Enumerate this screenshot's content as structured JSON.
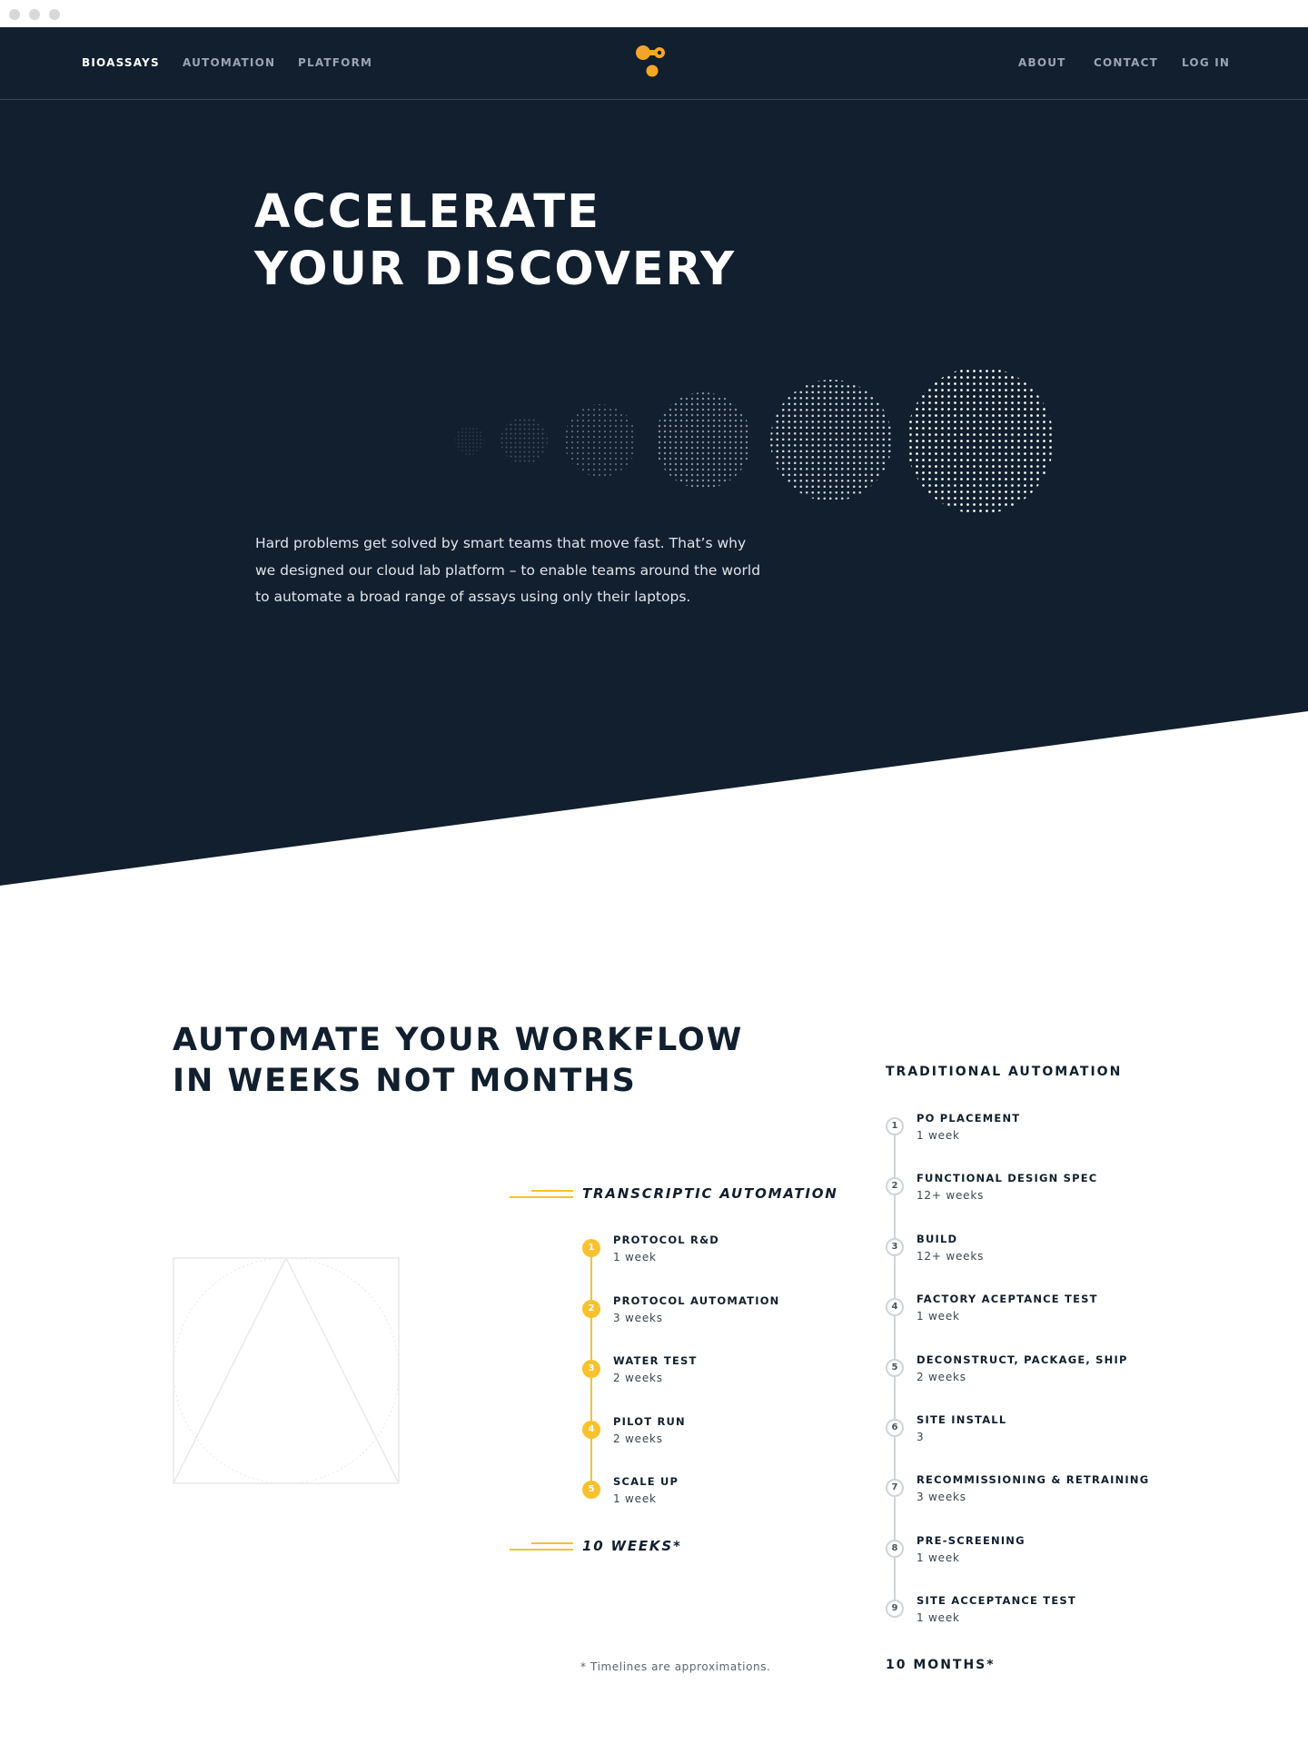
{
  "colors": {
    "navy": "#111f2e",
    "accent_yellow": "#f8c12d",
    "logo_orange": "#f6a623",
    "muted_grey": "#d0d4d8"
  },
  "browser": {
    "icons": [
      "window-dot-icon",
      "window-dot-icon",
      "window-dot-icon"
    ]
  },
  "nav": {
    "left": [
      {
        "label": "BIOASSAYS",
        "active": true
      },
      {
        "label": "AUTOMATION",
        "active": false
      },
      {
        "label": "PLATFORM",
        "active": false
      }
    ],
    "right": [
      {
        "label": "ABOUT"
      },
      {
        "label": "CONTACT"
      },
      {
        "label": "LOG IN"
      }
    ],
    "logo_icon": "transcriptic-logo-icon"
  },
  "hero": {
    "title_line1": "ACCELERATE",
    "title_line2": "YOUR DISCOVERY",
    "graphic_icon": "dotted-circles-graphic",
    "body": "Hard problems get solved by smart teams that move fast. That’s why we designed our cloud lab platform – to enable teams around the world to  automate a broad range of assays using only their laptops."
  },
  "workflow": {
    "title_line1": "AUTOMATE YOUR WORKFLOW",
    "title_line2": "IN WEEKS NOT MONTHS",
    "illustration_icon": "triangle-circle-square-icon",
    "transcriptic": {
      "heading": "TRANSCRIPTIC AUTOMATION",
      "steps": [
        {
          "num": "1",
          "name": "PROTOCOL R&D",
          "duration": "1 week"
        },
        {
          "num": "2",
          "name": "PROTOCOL AUTOMATION",
          "duration": "3 weeks"
        },
        {
          "num": "3",
          "name": "WATER TEST",
          "duration": "2 weeks"
        },
        {
          "num": "4",
          "name": "PILOT RUN",
          "duration": "2 weeks"
        },
        {
          "num": "5",
          "name": "SCALE UP",
          "duration": "1 week"
        }
      ],
      "total": "10 WEEKS*"
    },
    "traditional": {
      "heading": "TRADITIONAL AUTOMATION",
      "steps": [
        {
          "num": "1",
          "name": "PO PLACEMENT",
          "duration": "1 week"
        },
        {
          "num": "2",
          "name": "FUNCTIONAL DESIGN SPEC",
          "duration": "12+ weeks"
        },
        {
          "num": "3",
          "name": "BUILD",
          "duration": "12+ weeks"
        },
        {
          "num": "4",
          "name": "FACTORY ACEPTANCE TEST",
          "duration": "1 week"
        },
        {
          "num": "5",
          "name": "DECONSTRUCT, PACKAGE, SHIP",
          "duration": "2 weeks"
        },
        {
          "num": "6",
          "name": "SITE INSTALL",
          "duration": "3"
        },
        {
          "num": "7",
          "name": "RECOMMISSIONING & RETRAINING",
          "duration": "3 weeks"
        },
        {
          "num": "8",
          "name": "PRE-SCREENING",
          "duration": "1 week"
        },
        {
          "num": "9",
          "name": "SITE ACCEPTANCE TEST",
          "duration": "1 week"
        }
      ],
      "total": "10 MONTHS*"
    },
    "footnote": "*  Timelines are approximations."
  }
}
